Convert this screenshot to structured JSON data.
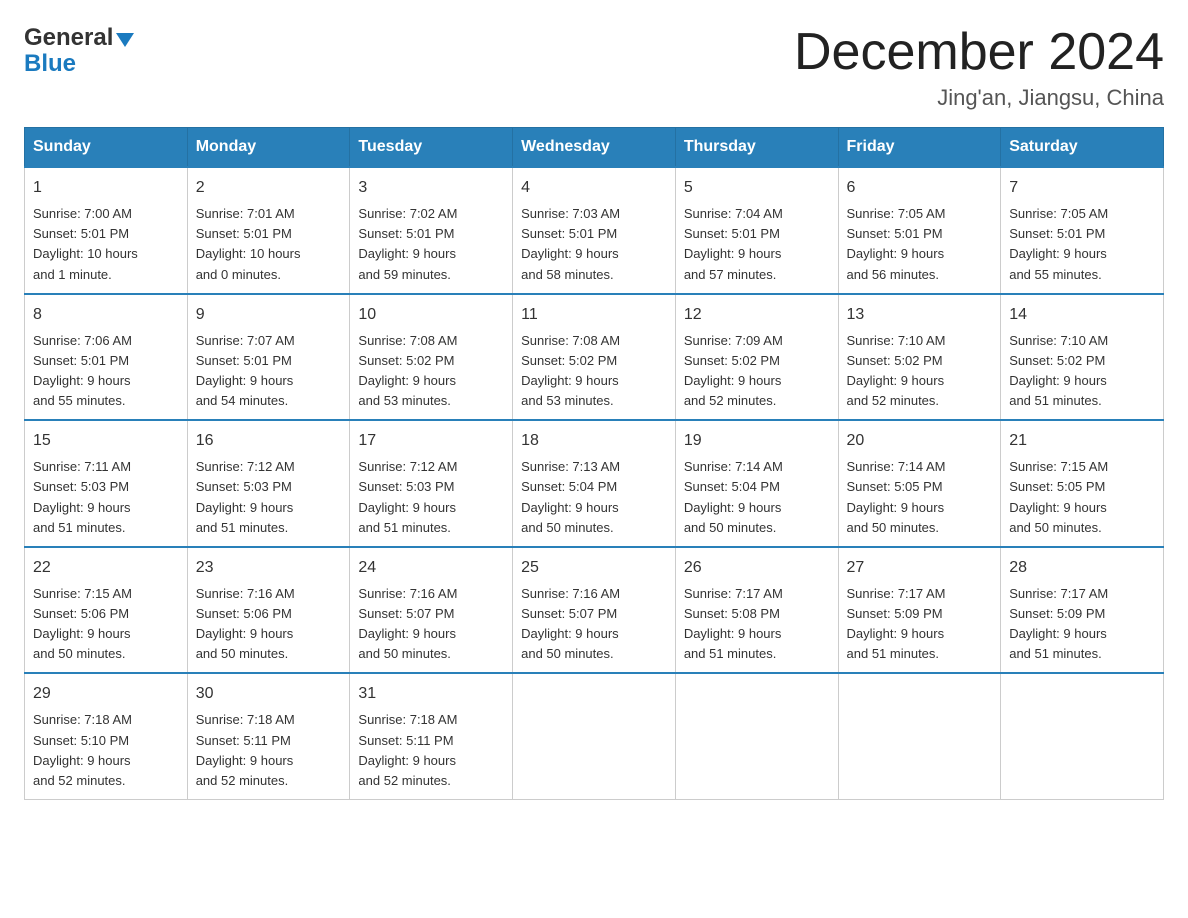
{
  "logo": {
    "general": "General",
    "blue": "Blue"
  },
  "title": "December 2024",
  "subtitle": "Jing'an, Jiangsu, China",
  "days_of_week": [
    "Sunday",
    "Monday",
    "Tuesday",
    "Wednesday",
    "Thursday",
    "Friday",
    "Saturday"
  ],
  "weeks": [
    [
      {
        "num": "1",
        "sunrise": "7:00 AM",
        "sunset": "5:01 PM",
        "daylight": "10 hours and 1 minute."
      },
      {
        "num": "2",
        "sunrise": "7:01 AM",
        "sunset": "5:01 PM",
        "daylight": "10 hours and 0 minutes."
      },
      {
        "num": "3",
        "sunrise": "7:02 AM",
        "sunset": "5:01 PM",
        "daylight": "9 hours and 59 minutes."
      },
      {
        "num": "4",
        "sunrise": "7:03 AM",
        "sunset": "5:01 PM",
        "daylight": "9 hours and 58 minutes."
      },
      {
        "num": "5",
        "sunrise": "7:04 AM",
        "sunset": "5:01 PM",
        "daylight": "9 hours and 57 minutes."
      },
      {
        "num": "6",
        "sunrise": "7:05 AM",
        "sunset": "5:01 PM",
        "daylight": "9 hours and 56 minutes."
      },
      {
        "num": "7",
        "sunrise": "7:05 AM",
        "sunset": "5:01 PM",
        "daylight": "9 hours and 55 minutes."
      }
    ],
    [
      {
        "num": "8",
        "sunrise": "7:06 AM",
        "sunset": "5:01 PM",
        "daylight": "9 hours and 55 minutes."
      },
      {
        "num": "9",
        "sunrise": "7:07 AM",
        "sunset": "5:01 PM",
        "daylight": "9 hours and 54 minutes."
      },
      {
        "num": "10",
        "sunrise": "7:08 AM",
        "sunset": "5:02 PM",
        "daylight": "9 hours and 53 minutes."
      },
      {
        "num": "11",
        "sunrise": "7:08 AM",
        "sunset": "5:02 PM",
        "daylight": "9 hours and 53 minutes."
      },
      {
        "num": "12",
        "sunrise": "7:09 AM",
        "sunset": "5:02 PM",
        "daylight": "9 hours and 52 minutes."
      },
      {
        "num": "13",
        "sunrise": "7:10 AM",
        "sunset": "5:02 PM",
        "daylight": "9 hours and 52 minutes."
      },
      {
        "num": "14",
        "sunrise": "7:10 AM",
        "sunset": "5:02 PM",
        "daylight": "9 hours and 51 minutes."
      }
    ],
    [
      {
        "num": "15",
        "sunrise": "7:11 AM",
        "sunset": "5:03 PM",
        "daylight": "9 hours and 51 minutes."
      },
      {
        "num": "16",
        "sunrise": "7:12 AM",
        "sunset": "5:03 PM",
        "daylight": "9 hours and 51 minutes."
      },
      {
        "num": "17",
        "sunrise": "7:12 AM",
        "sunset": "5:03 PM",
        "daylight": "9 hours and 51 minutes."
      },
      {
        "num": "18",
        "sunrise": "7:13 AM",
        "sunset": "5:04 PM",
        "daylight": "9 hours and 50 minutes."
      },
      {
        "num": "19",
        "sunrise": "7:14 AM",
        "sunset": "5:04 PM",
        "daylight": "9 hours and 50 minutes."
      },
      {
        "num": "20",
        "sunrise": "7:14 AM",
        "sunset": "5:05 PM",
        "daylight": "9 hours and 50 minutes."
      },
      {
        "num": "21",
        "sunrise": "7:15 AM",
        "sunset": "5:05 PM",
        "daylight": "9 hours and 50 minutes."
      }
    ],
    [
      {
        "num": "22",
        "sunrise": "7:15 AM",
        "sunset": "5:06 PM",
        "daylight": "9 hours and 50 minutes."
      },
      {
        "num": "23",
        "sunrise": "7:16 AM",
        "sunset": "5:06 PM",
        "daylight": "9 hours and 50 minutes."
      },
      {
        "num": "24",
        "sunrise": "7:16 AM",
        "sunset": "5:07 PM",
        "daylight": "9 hours and 50 minutes."
      },
      {
        "num": "25",
        "sunrise": "7:16 AM",
        "sunset": "5:07 PM",
        "daylight": "9 hours and 50 minutes."
      },
      {
        "num": "26",
        "sunrise": "7:17 AM",
        "sunset": "5:08 PM",
        "daylight": "9 hours and 51 minutes."
      },
      {
        "num": "27",
        "sunrise": "7:17 AM",
        "sunset": "5:09 PM",
        "daylight": "9 hours and 51 minutes."
      },
      {
        "num": "28",
        "sunrise": "7:17 AM",
        "sunset": "5:09 PM",
        "daylight": "9 hours and 51 minutes."
      }
    ],
    [
      {
        "num": "29",
        "sunrise": "7:18 AM",
        "sunset": "5:10 PM",
        "daylight": "9 hours and 52 minutes."
      },
      {
        "num": "30",
        "sunrise": "7:18 AM",
        "sunset": "5:11 PM",
        "daylight": "9 hours and 52 minutes."
      },
      {
        "num": "31",
        "sunrise": "7:18 AM",
        "sunset": "5:11 PM",
        "daylight": "9 hours and 52 minutes."
      },
      null,
      null,
      null,
      null
    ]
  ],
  "labels": {
    "sunrise": "Sunrise:",
    "sunset": "Sunset:",
    "daylight": "Daylight:"
  }
}
